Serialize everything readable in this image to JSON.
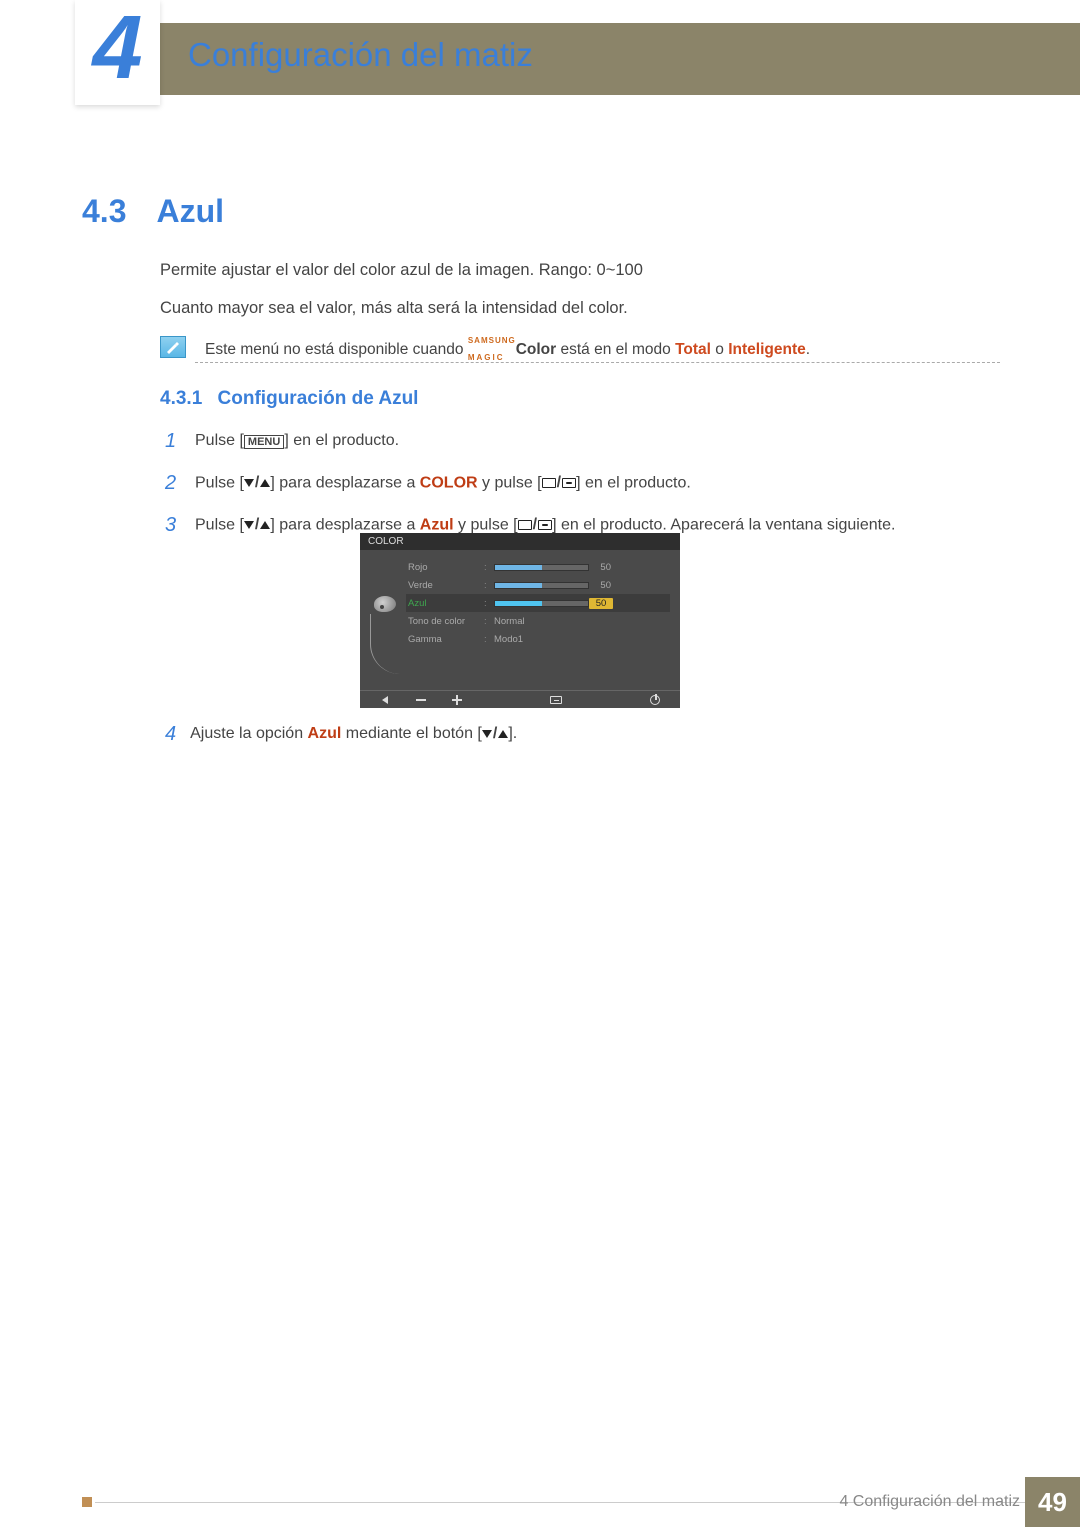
{
  "chapter": {
    "number": "4",
    "title": "Configuración del matiz"
  },
  "section": {
    "number": "4.3",
    "title": "Azul"
  },
  "paragraphs": {
    "p1": "Permite ajustar el valor del color azul de la imagen. Rango: 0~100",
    "p2": "Cuanto mayor sea el valor, más alta será la intensidad del color."
  },
  "note": {
    "prefix": "Este menú no está disponible cuando ",
    "magic_top": "SAMSUNG",
    "magic_bottom": "MAGIC",
    "magic_suffix": "Color",
    "mid": " está en el modo ",
    "mode1": "Total",
    "or": " o ",
    "mode2": "Inteligente",
    "end": "."
  },
  "subsection": {
    "number": "4.3.1",
    "title": "Configuración de Azul"
  },
  "steps": {
    "s1_a": "Pulse [",
    "s1_menu": "MENU",
    "s1_b": "] en el producto.",
    "s2_a": "Pulse [",
    "s2_b": "] para desplazarse a ",
    "s2_color": "COLOR",
    "s2_c": " y pulse [",
    "s2_d": "] en el producto.",
    "s3_a": "Pulse [",
    "s3_b": "] para desplazarse a ",
    "s3_azul": "Azul",
    "s3_c": " y pulse [",
    "s3_d": "] en el producto. Aparecerá la ventana siguiente.",
    "s4_a": "Ajuste la opción ",
    "s4_azul": "Azul",
    "s4_b": " mediante el botón [",
    "s4_c": "].",
    "n1": "1",
    "n2": "2",
    "n3": "3",
    "n4": "4"
  },
  "osd": {
    "title": "COLOR",
    "rows": [
      {
        "label": "Rojo",
        "value": "50",
        "fill": 50,
        "type": "bar"
      },
      {
        "label": "Verde",
        "value": "50",
        "fill": 50,
        "type": "bar"
      },
      {
        "label": "Azul",
        "value": "50",
        "fill": 50,
        "type": "bar",
        "selected": true
      },
      {
        "label": "Tono de color",
        "text": "Normal",
        "type": "text"
      },
      {
        "label": "Gamma",
        "text": "Modo1",
        "type": "text"
      }
    ]
  },
  "footer": {
    "chapter_label": "4 Configuración del matiz",
    "page": "49"
  }
}
